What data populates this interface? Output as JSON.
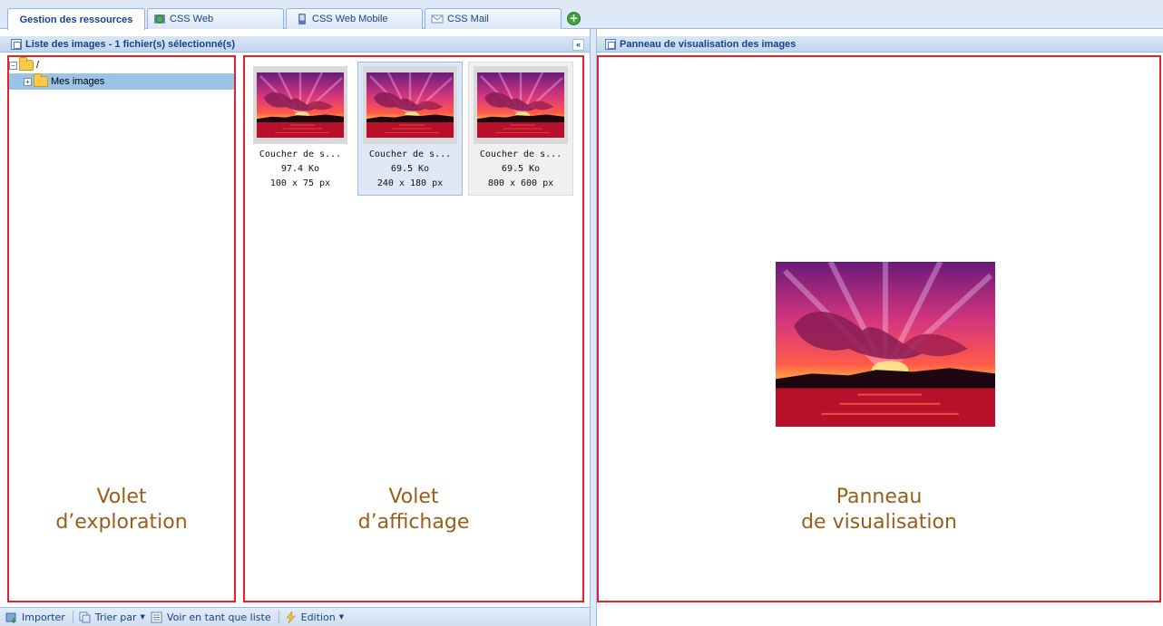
{
  "tabs": [
    {
      "label": "Gestion des ressources",
      "active": true
    },
    {
      "label": "CSS Web",
      "icon": "web-globe-icon"
    },
    {
      "label": "CSS Web Mobile",
      "icon": "mobile-phone-icon"
    },
    {
      "label": "CSS Mail",
      "icon": "mail-envelope-icon"
    }
  ],
  "left_panel": {
    "title": "Liste des images - 1 fichier(s) sélectionné(s)",
    "collapse_glyph": "«"
  },
  "right_panel": {
    "title": "Panneau de visualisation des images"
  },
  "tree": {
    "root": "/",
    "child": "Mes images"
  },
  "thumbnails": [
    {
      "name": "Coucher de s...",
      "size": "97.4 Ko",
      "dims": "100 x 75 px"
    },
    {
      "name": "Coucher de s...",
      "size": "69.5 Ko",
      "dims": "240 x 180 px",
      "selected": true
    },
    {
      "name": "Coucher de s...",
      "size": "69.5 Ko",
      "dims": "800 x 600 px"
    }
  ],
  "annotations": {
    "explore_1": "Volet",
    "explore_2": "d’exploration",
    "display_1": "Volet",
    "display_2": "d’affichage",
    "preview_1": "Panneau",
    "preview_2": "de visualisation"
  },
  "toolbar": {
    "import": "Importer",
    "sort": "Trier par",
    "list_view": "Voir en tant que liste",
    "edit": "Edition"
  },
  "colors": {
    "accent": "#15428b",
    "annotation_border": "#e3232c",
    "annotation_text": "#995e1a",
    "selection": "#99c6e8"
  }
}
